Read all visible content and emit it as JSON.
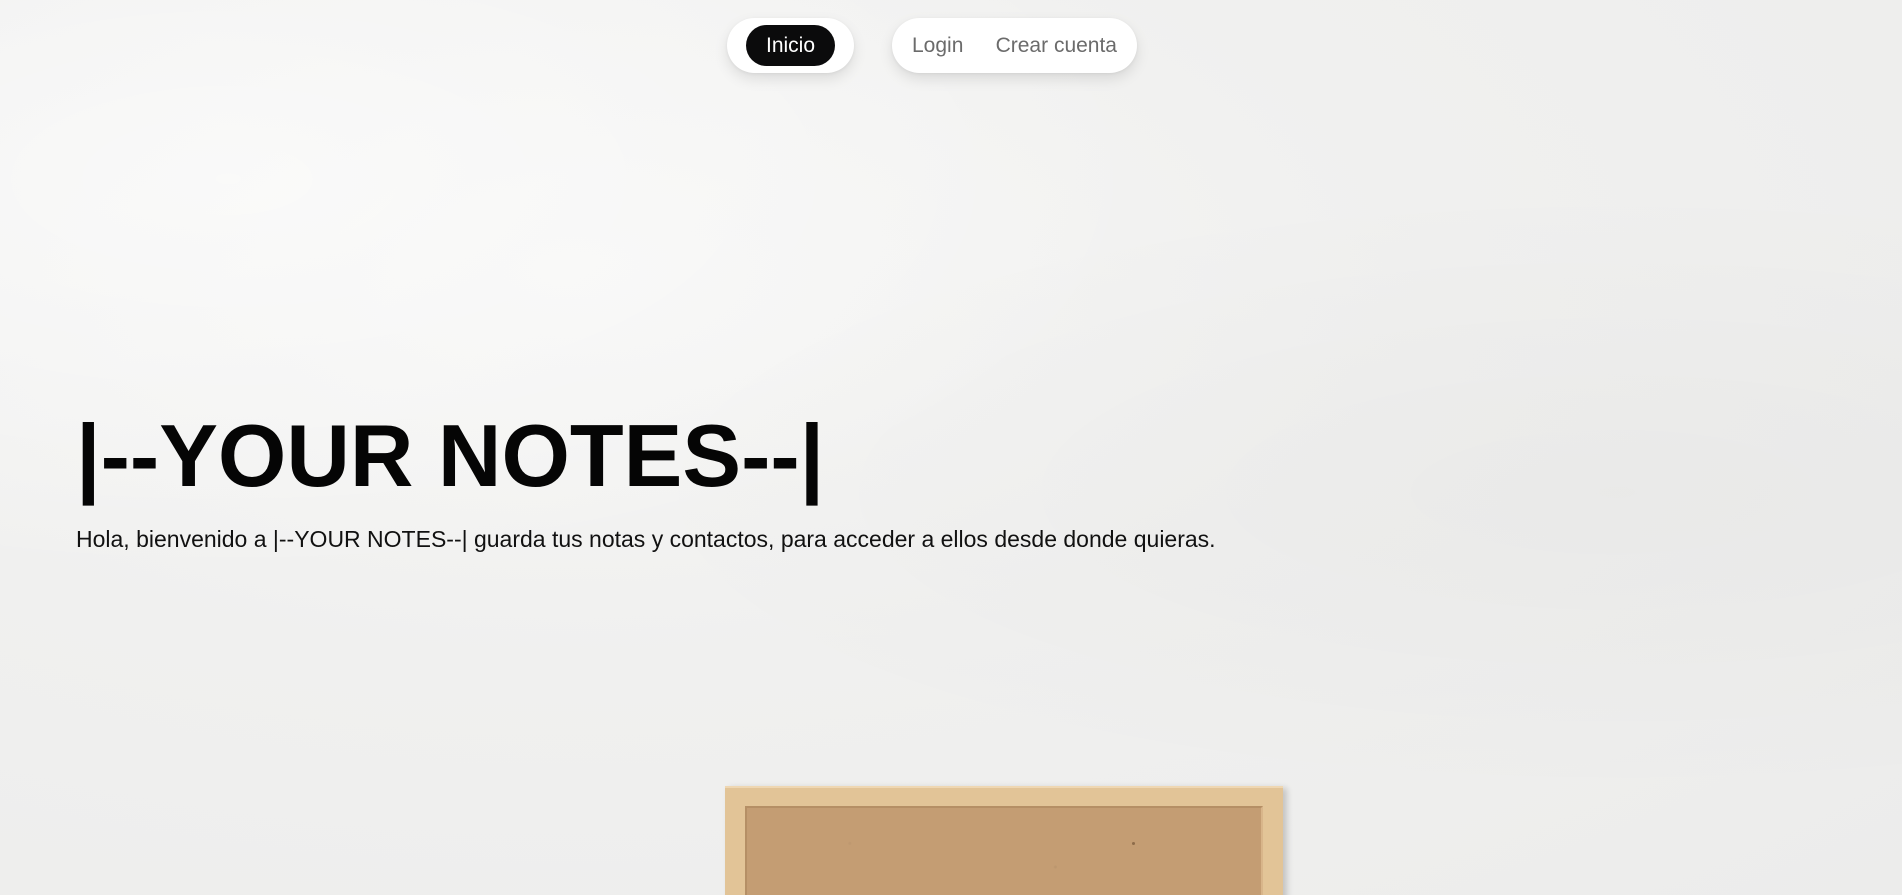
{
  "nav": {
    "home_label": "Inicio",
    "login_label": "Login",
    "register_label": "Crear cuenta"
  },
  "hero": {
    "title": "|--YOUR NOTES--|",
    "description": "Hola, bienvenido a |--YOUR NOTES--| guarda tus notas y contactos, para acceder a ellos desde donde quieras."
  },
  "colors": {
    "active_nav_bg": "#0b0b0c",
    "active_nav_text": "#ffffff",
    "nav_link_text": "#6b6b6b",
    "background": "#f0f0ef",
    "corkboard_frame": "#e2c497",
    "corkboard_surface": "#c49d73"
  },
  "decor": {
    "background_image": "corkboard-on-white-wall"
  }
}
